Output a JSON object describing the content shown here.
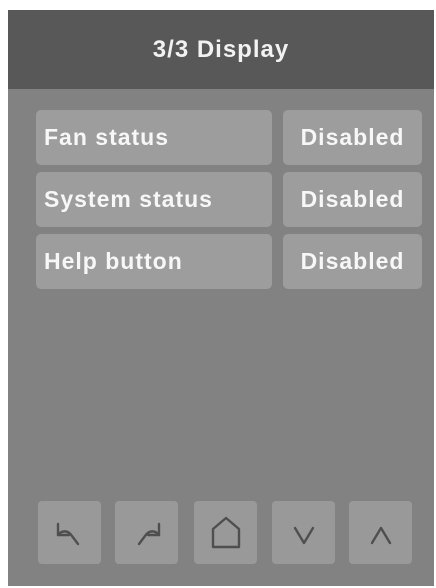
{
  "header": {
    "title": "3/3 Display"
  },
  "settings": [
    {
      "label": "Fan status",
      "value": "Disabled"
    },
    {
      "label": "System status",
      "value": "Disabled"
    },
    {
      "label": "Help button",
      "value": "Disabled"
    }
  ],
  "nav_buttons": [
    {
      "icon": "back-icon"
    },
    {
      "icon": "forward-icon"
    },
    {
      "icon": "home-icon"
    },
    {
      "icon": "chevron-down-icon"
    },
    {
      "icon": "chevron-up-icon"
    }
  ],
  "colors": {
    "screen_background": "#828282",
    "header_background": "#585858",
    "control_background": "#9d9d9d",
    "nav_button_background": "#999999",
    "text": "#f7f7f7",
    "icon_stroke": "#4f4f4f"
  }
}
